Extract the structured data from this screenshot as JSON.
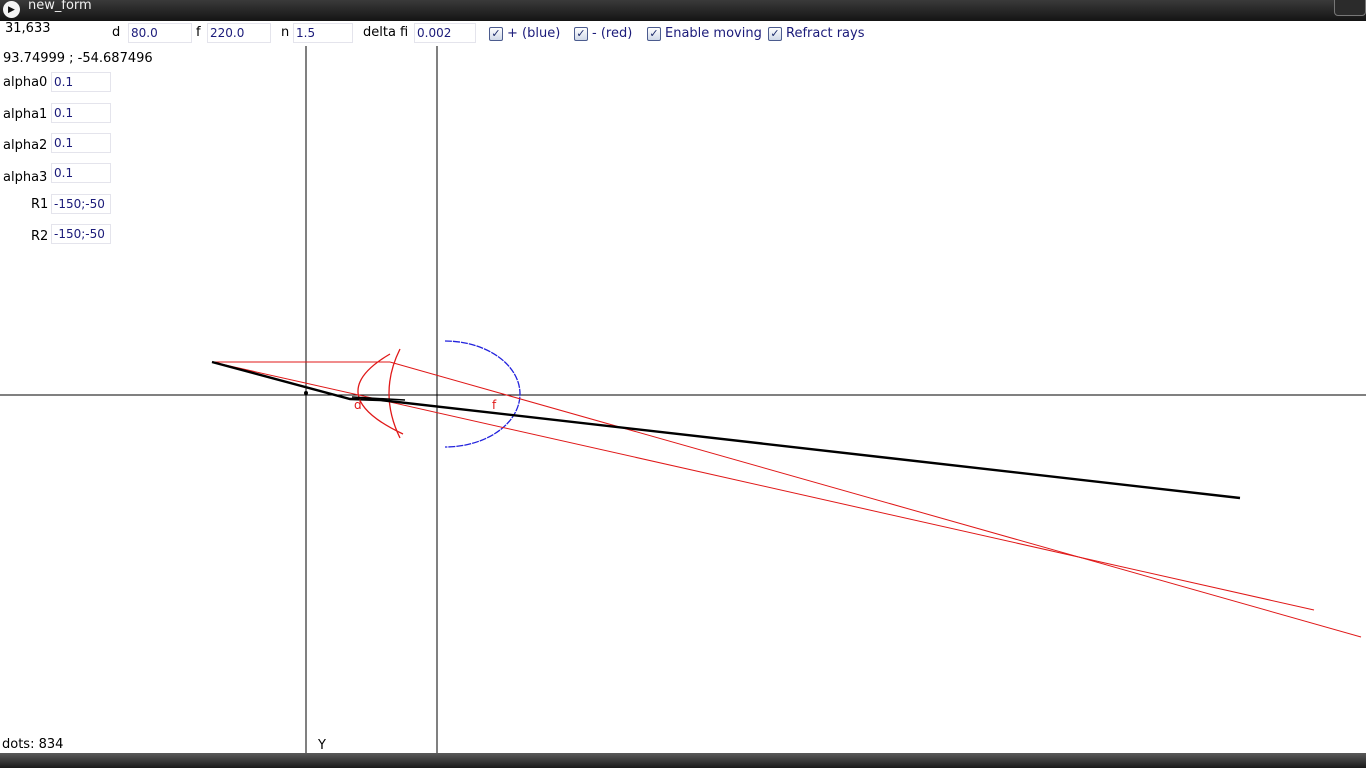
{
  "window": {
    "title": "new_form"
  },
  "status": {
    "mouse_coords": "31,633",
    "world_coords": "93.74999 ; -54.687496",
    "dots": "dots: 834",
    "axis_y_label": "Y"
  },
  "params": {
    "d": {
      "label": "d",
      "value": "80.0"
    },
    "f": {
      "label": "f",
      "value": "220.0"
    },
    "n": {
      "label": "n",
      "value": "1.5"
    },
    "delta_fi": {
      "label": "delta fi",
      "value": "0.002"
    }
  },
  "checkboxes": {
    "plus_blue": {
      "label": "+ (blue)",
      "checked": true
    },
    "minus_red": {
      "label": "- (red)",
      "checked": true
    },
    "enable_moving": {
      "label": "Enable moving",
      "checked": true
    },
    "refract_rays": {
      "label": "Refract rays",
      "checked": true
    }
  },
  "side_fields": {
    "alpha0": {
      "label": "alpha0",
      "value": "0.1"
    },
    "alpha1": {
      "label": "alpha1",
      "value": "0.1"
    },
    "alpha2": {
      "label": "alpha2",
      "value": "0.1"
    },
    "alpha3": {
      "label": "alpha3",
      "value": "0.1"
    },
    "r1": {
      "label": "R1",
      "value": "-150;-50"
    },
    "r2": {
      "label": "R2",
      "value": "-150;-50"
    }
  },
  "plot_labels": {
    "d_marker": "d",
    "f_marker": "f"
  },
  "colors": {
    "lens_plus": "#2222dd",
    "lens_minus": "#e01818",
    "rays": "#e01818",
    "main_ray": "#000000"
  }
}
